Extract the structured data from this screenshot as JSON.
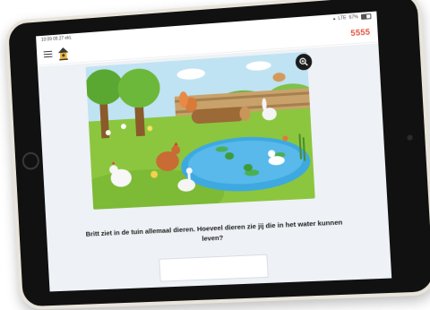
{
  "status_bar": {
    "time": "10:09",
    "date": "09.27 ekt.",
    "carrier": "LTE",
    "battery": "67%"
  },
  "header": {
    "score": "5555",
    "menu_icon": "hamburger-menu-icon",
    "logo_icon": "birdhouse-logo-icon"
  },
  "scene": {
    "zoom_icon": "zoom-in-icon"
  },
  "question": {
    "text": "Britt ziet in de tuin allemaal dieren. Hoeveel dieren zie jij die in het water kunnen leven?"
  },
  "answer": {
    "value": ""
  },
  "colors": {
    "score": "#e2553f",
    "sky": "#bfe3f2",
    "grass": "#8cc63f",
    "pond": "#3da9e0"
  }
}
